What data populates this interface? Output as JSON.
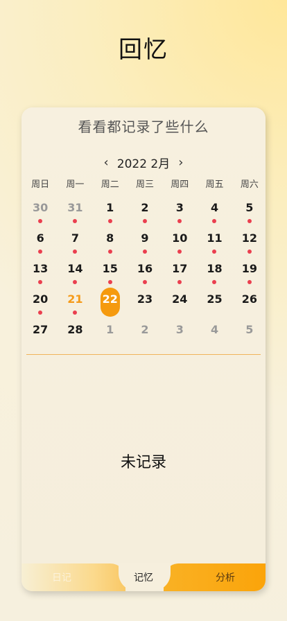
{
  "page": {
    "title": "回忆"
  },
  "card": {
    "title": "看看都记录了些什么"
  },
  "nav": {
    "prev_icon": "‹",
    "next_icon": "›",
    "month_label": "2022  2月"
  },
  "weekdays": [
    "周日",
    "周一",
    "周二",
    "周三",
    "周四",
    "周五",
    "周六"
  ],
  "calendar": {
    "weeks": [
      [
        {
          "d": "30",
          "m": true,
          "dot": true
        },
        {
          "d": "31",
          "m": true,
          "dot": true
        },
        {
          "d": "1",
          "dot": true
        },
        {
          "d": "2",
          "dot": true
        },
        {
          "d": "3",
          "dot": true
        },
        {
          "d": "4",
          "dot": true
        },
        {
          "d": "5",
          "dot": true
        }
      ],
      [
        {
          "d": "6",
          "dot": true
        },
        {
          "d": "7",
          "dot": true
        },
        {
          "d": "8",
          "dot": true
        },
        {
          "d": "9",
          "dot": true
        },
        {
          "d": "10",
          "dot": true
        },
        {
          "d": "11",
          "dot": true
        },
        {
          "d": "12",
          "dot": true
        }
      ],
      [
        {
          "d": "13",
          "dot": true
        },
        {
          "d": "14",
          "dot": true
        },
        {
          "d": "15",
          "dot": true
        },
        {
          "d": "16",
          "dot": true
        },
        {
          "d": "17",
          "dot": true
        },
        {
          "d": "18",
          "dot": true
        },
        {
          "d": "19",
          "dot": true
        }
      ],
      [
        {
          "d": "20",
          "dot": true
        },
        {
          "d": "21",
          "dot": true,
          "today": true
        },
        {
          "d": "22",
          "selected": true
        },
        {
          "d": "23"
        },
        {
          "d": "24"
        },
        {
          "d": "25"
        },
        {
          "d": "26"
        }
      ],
      [
        {
          "d": "27"
        },
        {
          "d": "28"
        },
        {
          "d": "1",
          "m": true
        },
        {
          "d": "2",
          "m": true
        },
        {
          "d": "3",
          "m": true
        },
        {
          "d": "4",
          "m": true
        },
        {
          "d": "5",
          "m": true
        }
      ]
    ]
  },
  "content": {
    "empty_text": "未记录"
  },
  "tabs": {
    "diary": "日记",
    "memory": "记忆",
    "analysis": "分析"
  },
  "colors": {
    "accent": "#f59a0e",
    "dot": "#ea3f4f",
    "divider": "#f0b35a"
  }
}
